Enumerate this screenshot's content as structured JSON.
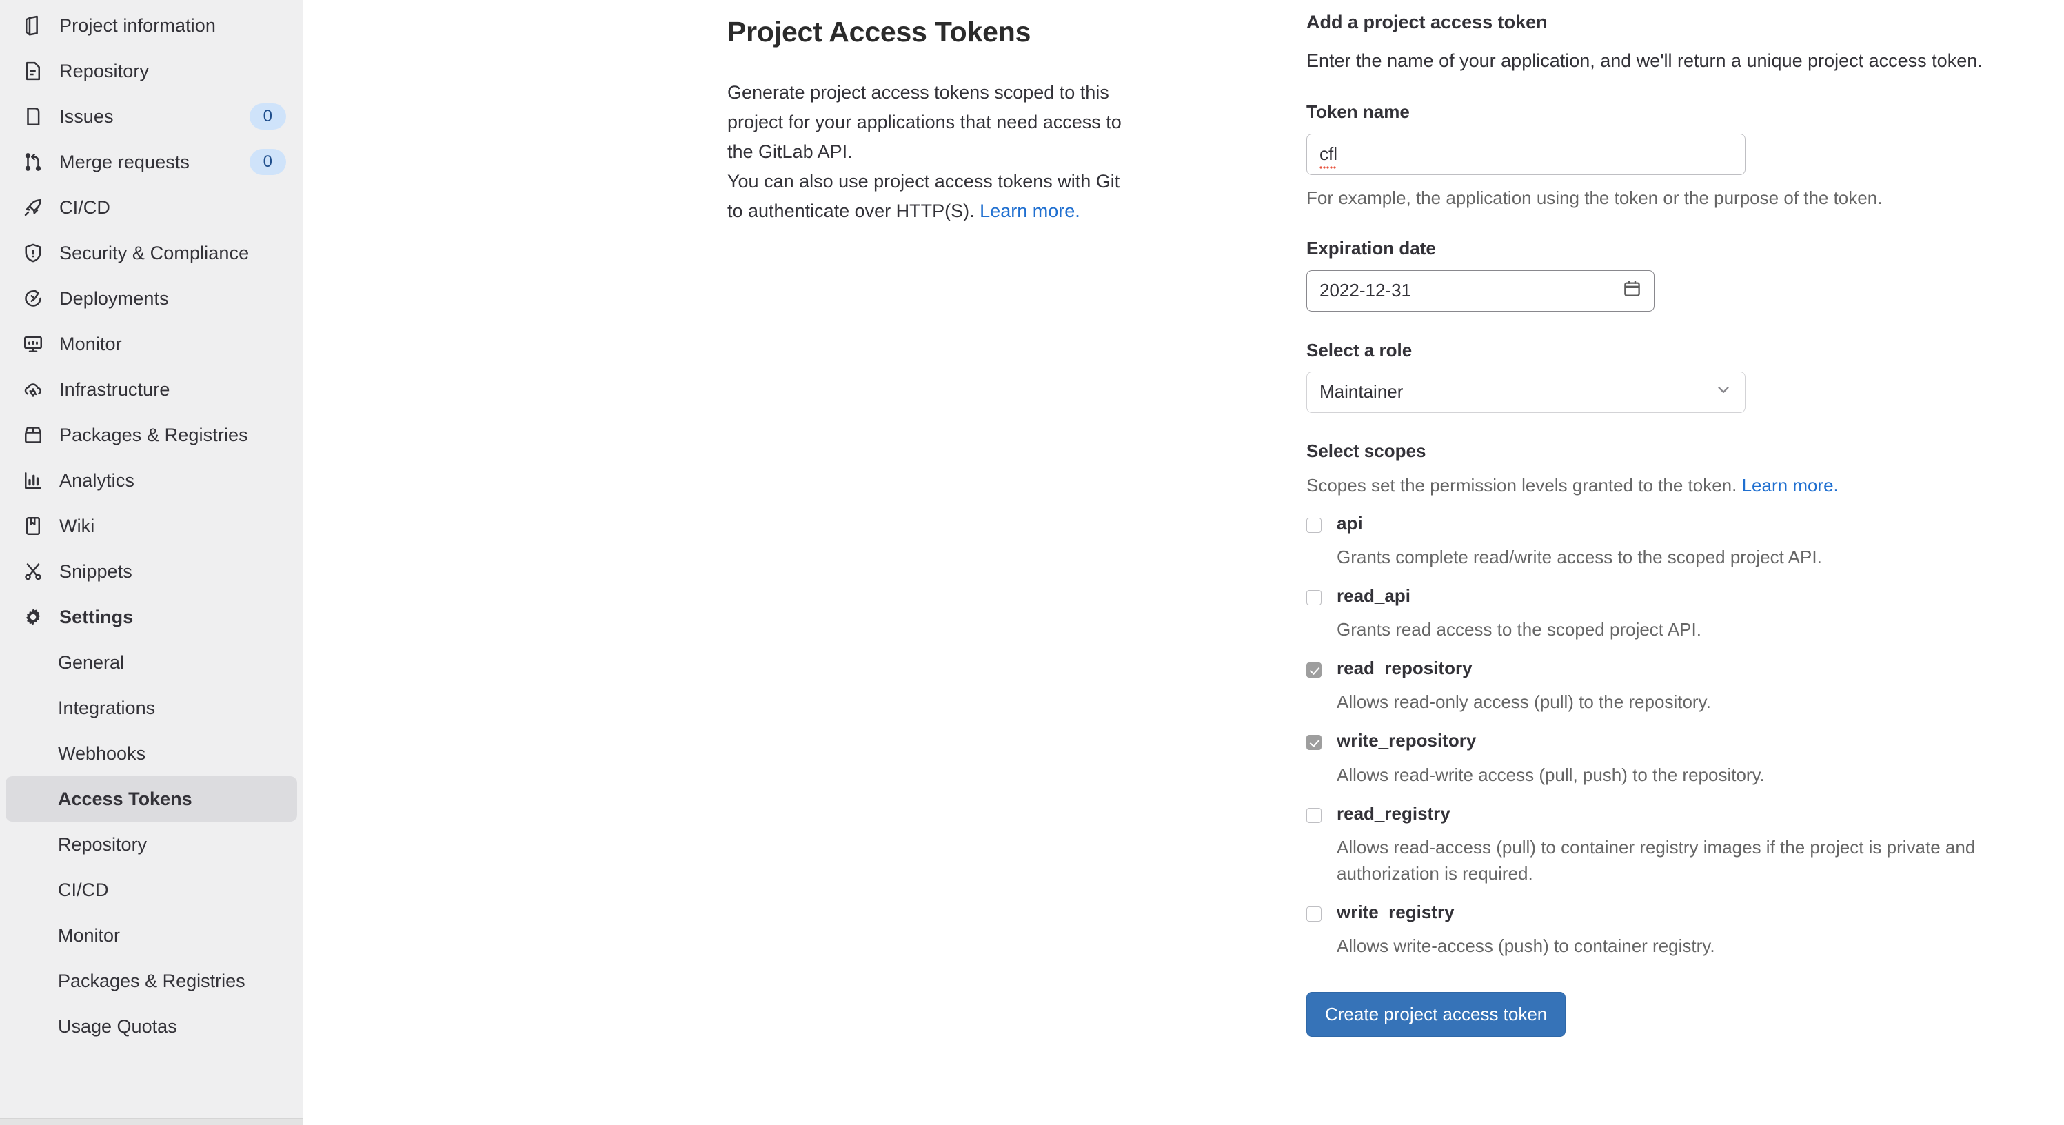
{
  "sidebar": {
    "nav": [
      {
        "label": "Project information",
        "icon": "project-information-icon",
        "badge": null
      },
      {
        "label": "Repository",
        "icon": "repository-icon",
        "badge": null
      },
      {
        "label": "Issues",
        "icon": "issues-icon",
        "badge": "0"
      },
      {
        "label": "Merge requests",
        "icon": "merge-requests-icon",
        "badge": "0"
      },
      {
        "label": "CI/CD",
        "icon": "rocket-icon",
        "badge": null
      },
      {
        "label": "Security & Compliance",
        "icon": "shield-icon",
        "badge": null
      },
      {
        "label": "Deployments",
        "icon": "deployments-icon",
        "badge": null
      },
      {
        "label": "Monitor",
        "icon": "monitor-icon",
        "badge": null
      },
      {
        "label": "Infrastructure",
        "icon": "cloud-gear-icon",
        "badge": null
      },
      {
        "label": "Packages & Registries",
        "icon": "package-icon",
        "badge": null
      },
      {
        "label": "Analytics",
        "icon": "chart-icon",
        "badge": null
      },
      {
        "label": "Wiki",
        "icon": "book-icon",
        "badge": null
      },
      {
        "label": "Snippets",
        "icon": "scissors-icon",
        "badge": null
      },
      {
        "label": "Settings",
        "icon": "gear-icon",
        "badge": null
      }
    ],
    "settings_sub": [
      {
        "label": "General",
        "active": false
      },
      {
        "label": "Integrations",
        "active": false
      },
      {
        "label": "Webhooks",
        "active": false
      },
      {
        "label": "Access Tokens",
        "active": true
      },
      {
        "label": "Repository",
        "active": false
      },
      {
        "label": "CI/CD",
        "active": false
      },
      {
        "label": "Monitor",
        "active": false
      },
      {
        "label": "Packages & Registries",
        "active": false
      },
      {
        "label": "Usage Quotas",
        "active": false
      }
    ]
  },
  "description": {
    "title": "Project Access Tokens",
    "paragraph1": "Generate project access tokens scoped to this project for your applications that need access to the GitLab API.",
    "paragraph2": "You can also use project access tokens with Git to authenticate over HTTP(S). ",
    "learn_more": "Learn more."
  },
  "form": {
    "heading": "Add a project access token",
    "subheading": "Enter the name of your application, and we'll return a unique project access token.",
    "token_name": {
      "label": "Token name",
      "value": "cfl",
      "placeholder": "",
      "help": "For example, the application using the token or the purpose of the token."
    },
    "expiration": {
      "label": "Expiration date",
      "value": "2022-12-31",
      "icon": "calendar-icon"
    },
    "role": {
      "label": "Select a role",
      "value": "Maintainer",
      "icon": "chevron-down-icon"
    },
    "scopes": {
      "heading": "Select scopes",
      "subtext": "Scopes set the permission levels granted to the token. ",
      "learn_more": "Learn more.",
      "items": [
        {
          "name": "api",
          "desc": "Grants complete read/write access to the scoped project API.",
          "checked": false
        },
        {
          "name": "read_api",
          "desc": "Grants read access to the scoped project API.",
          "checked": false
        },
        {
          "name": "read_repository",
          "desc": "Allows read-only access (pull) to the repository.",
          "checked": true
        },
        {
          "name": "write_repository",
          "desc": "Allows read-write access (pull, push) to the repository.",
          "checked": true
        },
        {
          "name": "read_registry",
          "desc": "Allows read-access (pull) to container registry images if the project is private and authorization is required.",
          "checked": false
        },
        {
          "name": "write_registry",
          "desc": "Allows write-access (push) to container registry.",
          "checked": false
        }
      ]
    },
    "submit_label": "Create project access token"
  },
  "colors": {
    "accent_blue": "#3673b8",
    "link_blue": "#1f6fd0",
    "sidebar_bg": "#efeff0",
    "active_bg": "#dcdcdf",
    "badge_bg": "#cfe3fa",
    "badge_text": "#1f4e8c"
  }
}
